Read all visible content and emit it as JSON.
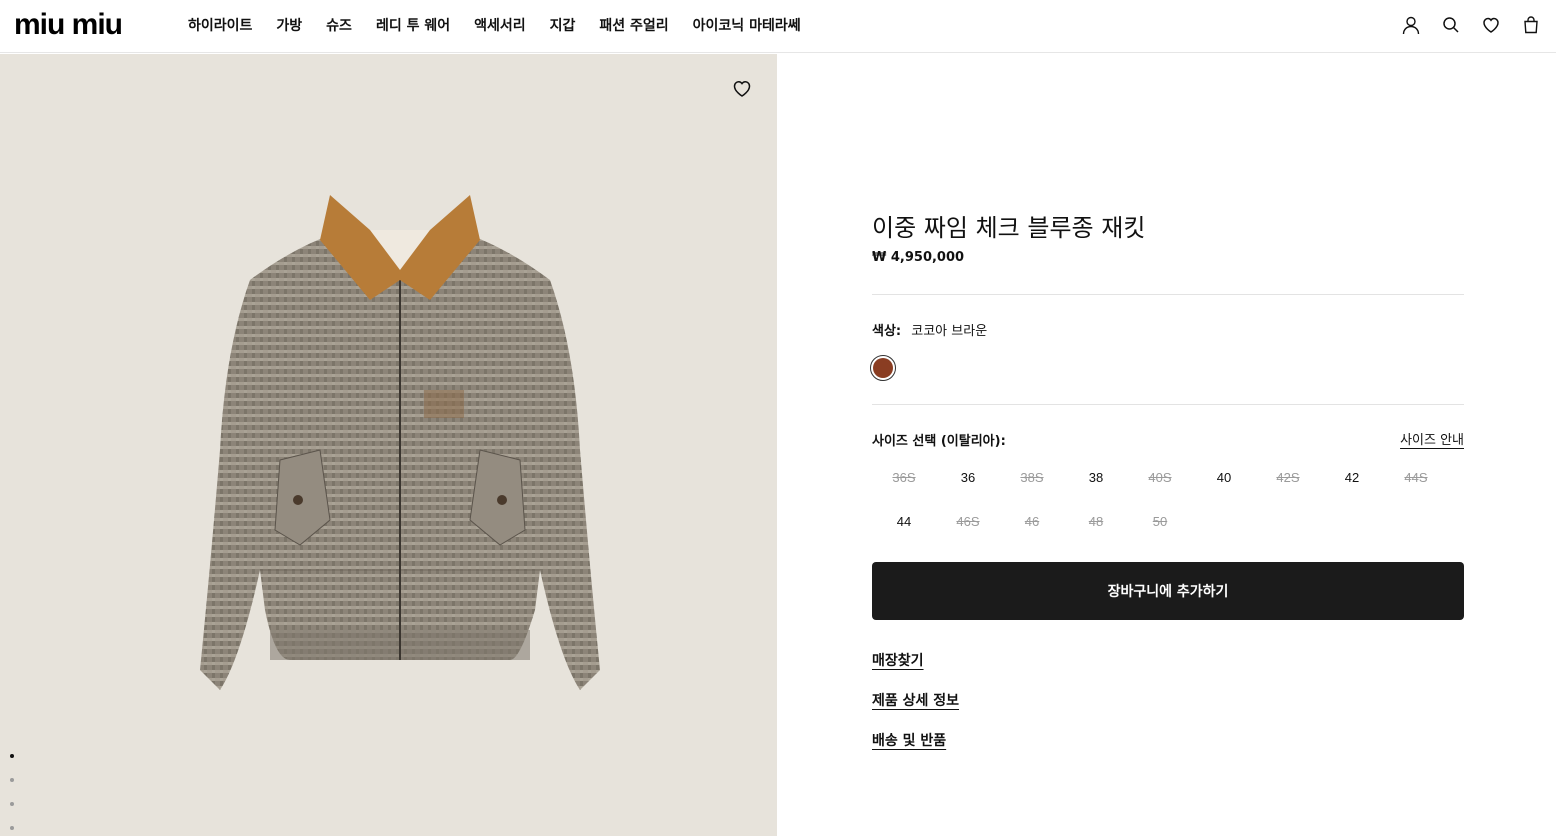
{
  "header": {
    "logo": "miu miu",
    "nav": [
      "하이라이트",
      "가방",
      "슈즈",
      "레디 투 웨어",
      "액세서리",
      "지갑",
      "패션 주얼리",
      "아이코닉 마테라쎄"
    ],
    "icons": [
      "user-icon",
      "search-icon",
      "heart-icon",
      "bag-icon"
    ]
  },
  "product": {
    "title": "이중 짜임 체크 블루종 재킷",
    "price": "₩ 4,950,000",
    "color_label": "색상:",
    "color_value": "코코아 브라운",
    "swatch_color": "#8a3d22",
    "size_label": "사이즈 선택 (이탈리아):",
    "size_guide": "사이즈 안내",
    "sizes": [
      {
        "label": "36S",
        "available": false
      },
      {
        "label": "36",
        "available": true
      },
      {
        "label": "38S",
        "available": false
      },
      {
        "label": "38",
        "available": true
      },
      {
        "label": "40S",
        "available": false
      },
      {
        "label": "40",
        "available": true
      },
      {
        "label": "42S",
        "available": false
      },
      {
        "label": "42",
        "available": true
      },
      {
        "label": "44S",
        "available": false
      },
      {
        "label": "44",
        "available": true
      },
      {
        "label": "46S",
        "available": false
      },
      {
        "label": "46",
        "available": false
      },
      {
        "label": "48",
        "available": false
      },
      {
        "label": "50",
        "available": false
      }
    ],
    "add_to_cart": "장바구니에 추가하기",
    "links": [
      "매장찾기",
      "제품 상세 정보",
      "배송 및 반품"
    ]
  },
  "gallery": {
    "background_color": "#e7e3db",
    "dots": 4,
    "active_dot": 0
  }
}
